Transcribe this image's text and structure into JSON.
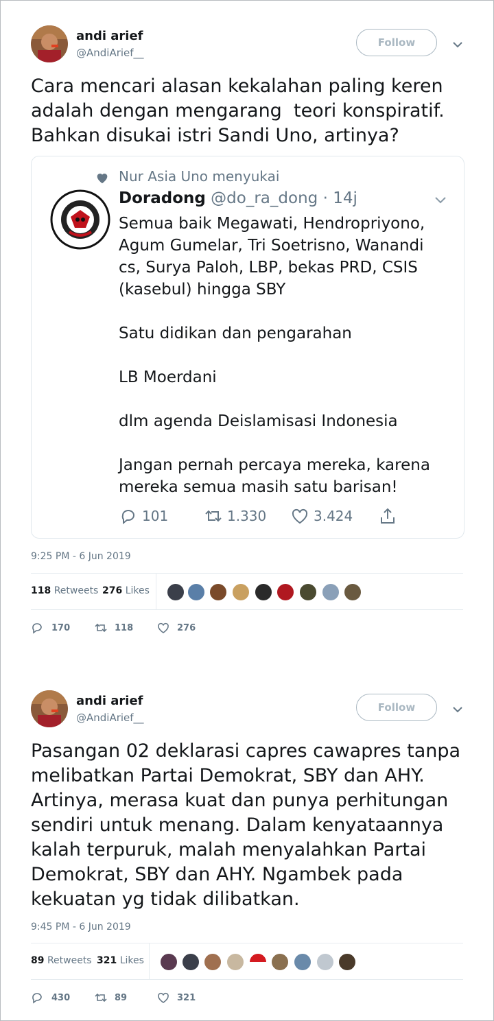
{
  "tweets": [
    {
      "author_name": "andi arief",
      "author_handle": "@AndiArief__",
      "follow_label": "Follow",
      "text": "Cara mencari alasan kekalahan paling keren\nadalah dengan mengarang  teori konspiratif.\nBahkan disukai istri Sandi Uno, artinya?",
      "quoted": {
        "liked_by": "Nur Asia Uno menyukai",
        "name": "Doradong",
        "handle": "@do_ra_dong",
        "sep": "·",
        "age": "14j",
        "text": "Semua baik Megawati, Hendropriyono,\nAgum Gumelar, Tri Soetrisno, Wanandi\ncs, Surya Paloh, LBP, bekas PRD, CSIS\n(kasebul) hingga SBY\n\nSatu didikan dan pengarahan\n\nLB Moerdani\n\ndlm agenda Deislamisasi Indonesia\n\nJangan pernah percaya mereka, karena\nmereka semua masih satu barisan!",
        "replies": "101",
        "retweets": "1.330",
        "likes": "3.424"
      },
      "timestamp": "9:25 PM - 6 Jun 2019",
      "retweet_count": "118",
      "retweet_label": "Retweets",
      "like_count": "276",
      "like_label": "Likes",
      "action_replies": "170",
      "action_retweets": "118",
      "action_likes": "276"
    },
    {
      "author_name": "andi arief",
      "author_handle": "@AndiArief__",
      "follow_label": "Follow",
      "text": "Pasangan 02 deklarasi capres cawapres tanpa\nmelibatkan Partai Demokrat, SBY dan AHY.\nArtinya, merasa kuat dan punya perhitungan\nsendiri untuk menang. Dalam kenyataannya\nkalah terpuruk, malah menyalahkan Partai\nDemokrat, SBY dan AHY. Ngambek pada\nkekuatan yg tidak dilibatkan.",
      "timestamp": "9:45 PM - 6 Jun 2019",
      "retweet_count": "89",
      "retweet_label": "Retweets",
      "like_count": "321",
      "like_label": "Likes",
      "action_replies": "430",
      "action_retweets": "89",
      "action_likes": "321"
    }
  ],
  "colors": {
    "text": "#14171a",
    "muted": "#657786",
    "border": "#e6ecf0",
    "follow_border": "#aab8c2"
  }
}
